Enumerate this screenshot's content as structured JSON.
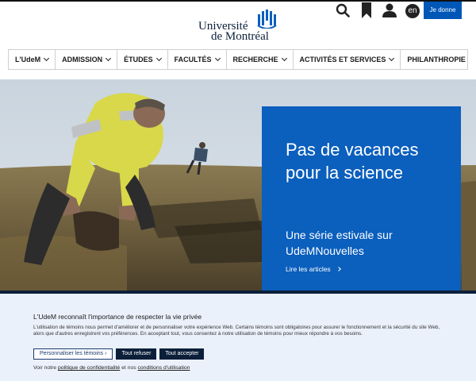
{
  "header": {
    "logo_line1": "Université",
    "logo_line2": "de Montréal",
    "lang_label": "en",
    "donate_label": "Je donne"
  },
  "nav": {
    "items": [
      {
        "label": "L'UdeM"
      },
      {
        "label": "ADMISSION"
      },
      {
        "label": "ÉTUDES"
      },
      {
        "label": "FACULTÉS"
      },
      {
        "label": "RECHERCHE"
      },
      {
        "label": "ACTIVITÉS ET SERVICES"
      },
      {
        "label": "PHILANTHROPIE"
      }
    ]
  },
  "hero": {
    "title": "Pas de vacances pour la science",
    "subtitle": "Une série estivale sur UdeMNouvelles",
    "link_label": "Lire les articles"
  },
  "cookie": {
    "title": "L'UdeM reconnaît l'importance de respecter la vie privée",
    "text": "L'utilisation de témoins nous permet d'améliorer et de personnaliser votre expérience Web. Certains témoins sont obligatoires pour assurer le fonctionnement et la sécurité du site Web, alors que d'autres enregistrent vos préférences. En acceptant tout, vous consentez à notre utilisation de témoins pour mieux répondre à vos besoins.",
    "btn_customize": "Personnaliser les témoins",
    "btn_refuse": "Tout refuser",
    "btn_accept": "Tout accepter",
    "links_prefix": "Voir notre",
    "privacy_link": "politique de confidentialité",
    "links_middle": "et nos",
    "terms_link": "conditions d'utilisation"
  },
  "colors": {
    "brand_blue": "#0b5fbd",
    "navy": "#0b1f3a",
    "donate_blue": "#0057b8",
    "banner_bg": "#eaf1fb"
  }
}
